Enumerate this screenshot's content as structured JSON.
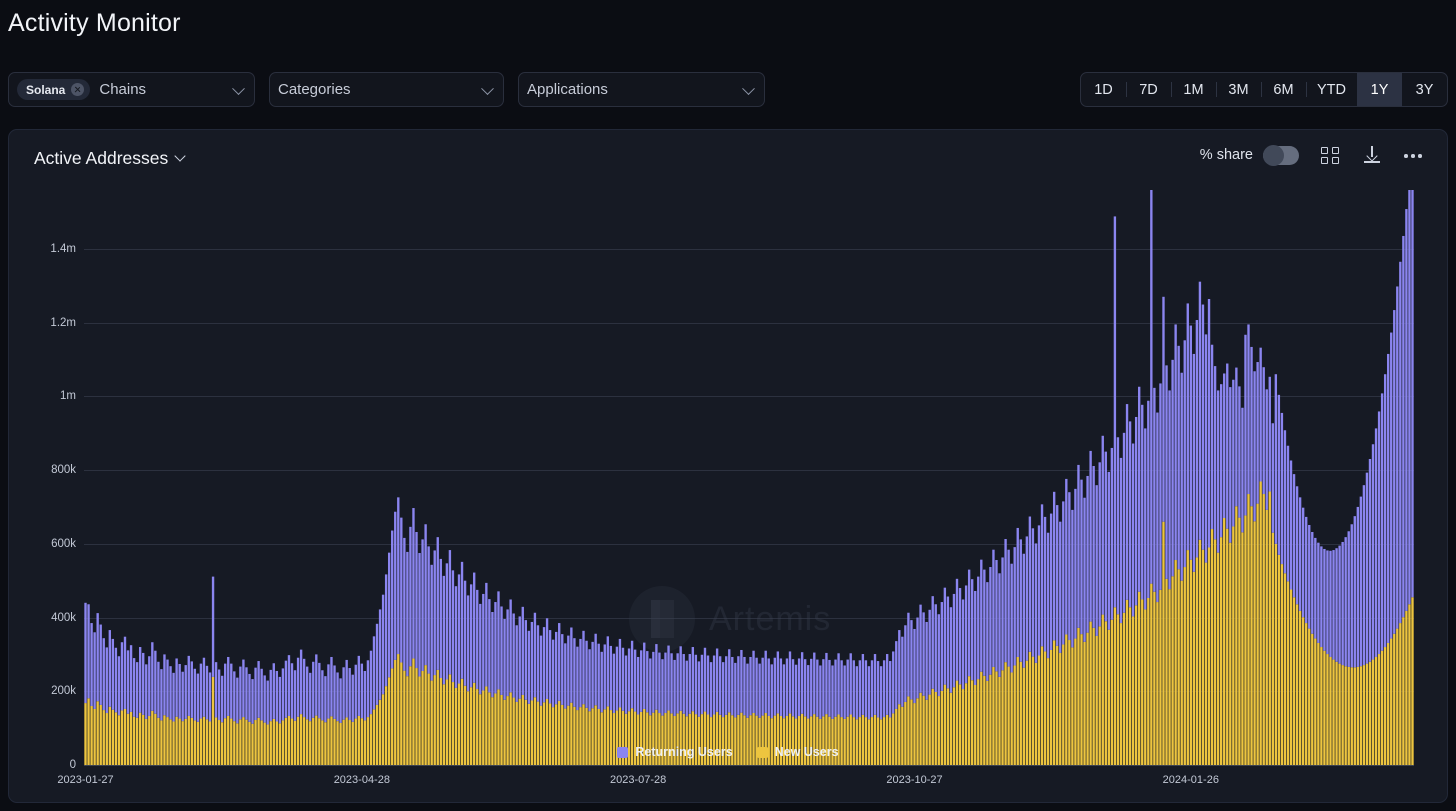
{
  "header": {
    "title": "Activity Monitor"
  },
  "filters": [
    {
      "name": "chains",
      "chip": "Solana",
      "placeholder": "Chains",
      "icon": "chevron-down-icon"
    },
    {
      "name": "categories",
      "chip": null,
      "placeholder": "Categories",
      "icon": "chevron-down-icon"
    },
    {
      "name": "applications",
      "chip": null,
      "placeholder": "Applications",
      "icon": "chevron-down-icon"
    }
  ],
  "range_selector": {
    "options": [
      "1D",
      "7D",
      "1M",
      "3M",
      "6M",
      "YTD",
      "1Y",
      "3Y"
    ],
    "selected": "1Y"
  },
  "card": {
    "title": "Active Addresses",
    "title_icon": "chevron-down-icon",
    "tools": {
      "share_label": "% share",
      "share_toggle_on": false,
      "grid_icon": "grid-icon",
      "download_icon": "download-icon",
      "more_icon": "more-options-icon"
    },
    "watermark": "Artemis"
  },
  "chart_data": {
    "type": "bar",
    "stacked": true,
    "title": "Active Addresses",
    "xlabel": "",
    "ylabel": "",
    "grid": true,
    "legend_position": "bottom",
    "ylim": [
      0,
      1500000
    ],
    "ytick_values": [
      0,
      200000,
      400000,
      600000,
      800000,
      1000000,
      1200000,
      1400000
    ],
    "ytick_labels": [
      "0",
      "200k",
      "400k",
      "600k",
      "800k",
      "1m",
      "1.2m",
      "1.4m"
    ],
    "xtick_labels": [
      "2023-01-27",
      "2023-04-28",
      "2023-07-28",
      "2023-10-27",
      "2024-01-26"
    ],
    "xtick_indices": [
      0,
      91,
      182,
      273,
      364
    ],
    "colors": {
      "Returning Users": "#8b85f0",
      "New Users": "#edc53f"
    },
    "series": [
      {
        "name": "New Users",
        "color": "#edc53f",
        "values": [
          168000,
          181000,
          160000,
          152000,
          173000,
          163000,
          149000,
          141000,
          158000,
          150000,
          143000,
          135000,
          148000,
          152000,
          139000,
          144000,
          131000,
          128000,
          142000,
          136000,
          125000,
          133000,
          147000,
          139000,
          128000,
          121000,
          135000,
          130000,
          124000,
          118000,
          131000,
          126000,
          119000,
          125000,
          133000,
          128000,
          121000,
          117000,
          126000,
          131000,
          124000,
          118000,
          239000,
          129000,
          122000,
          116000,
          127000,
          133000,
          126000,
          119000,
          113000,
          124000,
          130000,
          123000,
          117000,
          112000,
          122000,
          128000,
          121000,
          115000,
          110000,
          119000,
          125000,
          118000,
          113000,
          121000,
          128000,
          133000,
          126000,
          120000,
          131000,
          138000,
          130000,
          124000,
          119000,
          128000,
          134000,
          127000,
          121000,
          116000,
          126000,
          132000,
          125000,
          119000,
          114000,
          123000,
          129000,
          122000,
          117000,
          126000,
          133000,
          127000,
          121000,
          130000,
          138000,
          151000,
          163000,
          177000,
          192000,
          214000,
          238000,
          262000,
          285000,
          301000,
          278000,
          256000,
          241000,
          268000,
          289000,
          263000,
          240000,
          255000,
          271000,
          248000,
          229000,
          244000,
          258000,
          236000,
          219000,
          232000,
          246000,
          225000,
          209000,
          221000,
          234000,
          215000,
          200000,
          211000,
          223000,
          206000,
          192000,
          202000,
          213000,
          197000,
          184000,
          194000,
          205000,
          190000,
          177000,
          187000,
          197000,
          183000,
          171000,
          180000,
          190000,
          177000,
          166000,
          175000,
          184000,
          172000,
          161000,
          170000,
          179000,
          167000,
          157000,
          165000,
          174000,
          163000,
          153000,
          161000,
          169000,
          158000,
          149000,
          157000,
          165000,
          155000,
          146000,
          154000,
          162000,
          152000,
          143000,
          151000,
          159000,
          149000,
          141000,
          148000,
          156000,
          147000,
          139000,
          146000,
          154000,
          145000,
          137000,
          144000,
          152000,
          143000,
          135000,
          142000,
          150000,
          141000,
          134000,
          141000,
          148000,
          140000,
          133000,
          140000,
          147000,
          139000,
          132000,
          139000,
          146000,
          138000,
          131000,
          138000,
          145000,
          137000,
          130000,
          137000,
          144000,
          136000,
          130000,
          136000,
          143000,
          135000,
          129000,
          136000,
          142000,
          135000,
          128000,
          135000,
          141000,
          134000,
          128000,
          134000,
          141000,
          133000,
          127000,
          134000,
          140000,
          133000,
          127000,
          133000,
          140000,
          132000,
          126000,
          133000,
          139000,
          132000,
          126000,
          132000,
          138000,
          131000,
          125000,
          132000,
          138000,
          131000,
          125000,
          131000,
          137000,
          130000,
          125000,
          131000,
          137000,
          130000,
          124000,
          130000,
          136000,
          130000,
          124000,
          130000,
          136000,
          129000,
          124000,
          130000,
          136000,
          129000,
          140000,
          152000,
          165000,
          158000,
          171000,
          186000,
          178000,
          168000,
          181000,
          196000,
          188000,
          177000,
          191000,
          207000,
          198000,
          187000,
          201000,
          218000,
          208000,
          196000,
          211000,
          229000,
          219000,
          206000,
          222000,
          241000,
          230000,
          217000,
          233000,
          253000,
          242000,
          228000,
          245000,
          266000,
          254000,
          239000,
          257000,
          279000,
          267000,
          251000,
          270000,
          293000,
          280000,
          264000,
          283000,
          307000,
          294000,
          277000,
          297000,
          322000,
          308000,
          290000,
          312000,
          338000,
          323000,
          304000,
          327000,
          354000,
          339000,
          319000,
          343000,
          372000,
          355000,
          334000,
          359000,
          389000,
          372000,
          350000,
          376000,
          408000,
          390000,
          367000,
          394000,
          428000,
          409000,
          385000,
          413000,
          448000,
          428000,
          403000,
          433000,
          470000,
          449000,
          422000,
          453000,
          492000,
          470000,
          442000,
          475000,
          660000,
          505000,
          477000,
          512000,
          556000,
          531000,
          500000,
          537000,
          583000,
          557000,
          524000,
          563000,
          611000,
          584000,
          549000,
          590000,
          640000,
          612000,
          576000,
          618000,
          670000,
          641000,
          603000,
          647000,
          702000,
          671000,
          631000,
          677000,
          735000,
          702000,
          661000,
          709000,
          769000,
          735000,
          692000,
          742000,
          630000,
          600000,
          570000,
          545000,
          520000,
          498000,
          476000,
          455000,
          436000,
          418000,
          401000,
          385000,
          370000,
          356000,
          343000,
          331000,
          320000,
          310000,
          301000,
          293000,
          286000,
          280000,
          275000,
          271000,
          268000,
          266000,
          265000,
          265000,
          266000,
          268000,
          271000,
          275000,
          280000,
          286000,
          293000,
          301000,
          310000,
          320000,
          331000,
          343000,
          356000,
          370000,
          385000,
          401000,
          418000,
          436000,
          455000
        ]
      },
      {
        "name": "Returning Users",
        "color": "#8b85f0",
        "values": [
          272000,
          255000,
          225000,
          208000,
          239000,
          218000,
          195000,
          178000,
          208000,
          192000,
          175000,
          160000,
          185000,
          196000,
          172000,
          181000,
          159000,
          151000,
          178000,
          168000,
          148000,
          162000,
          186000,
          171000,
          152000,
          139000,
          165000,
          156000,
          144000,
          132000,
          158000,
          148000,
          134000,
          146000,
          163000,
          153000,
          140000,
          131000,
          149000,
          160000,
          145000,
          133000,
          272000,
          150000,
          137000,
          126000,
          148000,
          160000,
          149000,
          135000,
          124000,
          143000,
          156000,
          142000,
          130000,
          121000,
          142000,
          154000,
          140000,
          128000,
          119000,
          139000,
          151000,
          137000,
          126000,
          141000,
          155000,
          165000,
          150000,
          137000,
          160000,
          175000,
          158000,
          143000,
          131000,
          152000,
          166000,
          150000,
          136000,
          125000,
          147000,
          161000,
          145000,
          132000,
          121000,
          142000,
          156000,
          141000,
          128000,
          146000,
          163000,
          148000,
          134000,
          154000,
          172000,
          198000,
          220000,
          245000,
          270000,
          303000,
          338000,
          374000,
          402000,
          425000,
          393000,
          360000,
          337000,
          378000,
          408000,
          369000,
          335000,
          357000,
          382000,
          345000,
          314000,
          338000,
          360000,
          323000,
          294000,
          315000,
          337000,
          303000,
          276000,
          296000,
          317000,
          285000,
          260000,
          279000,
          299000,
          269000,
          245000,
          262000,
          281000,
          253000,
          231000,
          248000,
          266000,
          240000,
          219000,
          235000,
          252000,
          228000,
          208000,
          223000,
          239000,
          216000,
          198000,
          213000,
          229000,
          207000,
          190000,
          204000,
          219000,
          199000,
          183000,
          196000,
          211000,
          192000,
          177000,
          190000,
          204000,
          186000,
          172000,
          185000,
          199000,
          182000,
          168000,
          180000,
          194000,
          177000,
          164000,
          176000,
          190000,
          174000,
          161000,
          173000,
          186000,
          171000,
          158000,
          170000,
          183000,
          168000,
          156000,
          167000,
          180000,
          166000,
          154000,
          165000,
          178000,
          164000,
          153000,
          164000,
          176000,
          163000,
          152000,
          163000,
          175000,
          162000,
          151000,
          162000,
          174000,
          161000,
          150000,
          161000,
          173000,
          160000,
          149000,
          160000,
          172000,
          159000,
          149000,
          159000,
          171000,
          158000,
          148000,
          159000,
          170000,
          158000,
          147000,
          158000,
          169000,
          157000,
          147000,
          157000,
          169000,
          156000,
          146000,
          157000,
          168000,
          156000,
          146000,
          156000,
          168000,
          155000,
          146000,
          156000,
          167000,
          155000,
          145000,
          156000,
          167000,
          155000,
          145000,
          155000,
          166000,
          154000,
          145000,
          155000,
          166000,
          154000,
          145000,
          155000,
          166000,
          154000,
          144000,
          154000,
          165000,
          154000,
          144000,
          154000,
          165000,
          153000,
          144000,
          154000,
          165000,
          153000,
          168000,
          184000,
          201000,
          190000,
          208000,
          227000,
          215000,
          201000,
          219000,
          239000,
          226000,
          211000,
          230000,
          251000,
          238000,
          222000,
          241000,
          263000,
          249000,
          232000,
          253000,
          276000,
          261000,
          243000,
          265000,
          289000,
          274000,
          255000,
          278000,
          304000,
          288000,
          268000,
          292000,
          318000,
          302000,
          281000,
          306000,
          334000,
          317000,
          295000,
          321000,
          350000,
          332000,
          309000,
          337000,
          367000,
          348000,
          324000,
          353000,
          385000,
          365000,
          340000,
          370000,
          403000,
          382000,
          356000,
          388000,
          422000,
          401000,
          373000,
          406000,
          442000,
          419000,
          391000,
          425000,
          463000,
          439000,
          409000,
          445000,
          485000,
          460000,
          428000,
          466000,
          1060000,
          480000,
          448000,
          488000,
          531000,
          504000,
          469000,
          511000,
          556000,
          528000,
          491000,
          535000,
          1262000,
          553000,
          514000,
          560000,
          610000,
          579000,
          539000,
          587000,
          639000,
          606000,
          564000,
          615000,
          669000,
          635000,
          591000,
          644000,
          700000,
          665000,
          619000,
          674000,
          500000,
          470000,
          440000,
          415000,
          392000,
          448000,
          422000,
          398000,
          376000,
          356000,
          338000,
          490000,
          460000,
          432000,
          407000,
          384000,
          363000,
          344000,
          327000,
          311000,
          297000,
          460000,
          434000,
          410000,
          388000,
          368000,
          350000,
          334000,
          320000,
          308000,
          297000,
          288000,
          281000,
          276000,
          273000,
          272000,
          273000,
          276000,
          281000,
          288000,
          297000,
          308000,
          320000,
          334000,
          350000,
          368000,
          388000,
          410000,
          434000,
          460000,
          488000,
          518000,
          550000,
          584000,
          620000,
          658000,
          698000,
          740000,
          784000,
          830000,
          878000,
          928000,
          980000,
          1034000,
          1090000,
          1148000,
          1170000
        ]
      }
    ],
    "legend": [
      {
        "label": "Returning Users",
        "color": "#8b85f0"
      },
      {
        "label": "New Users",
        "color": "#edc53f"
      }
    ]
  }
}
